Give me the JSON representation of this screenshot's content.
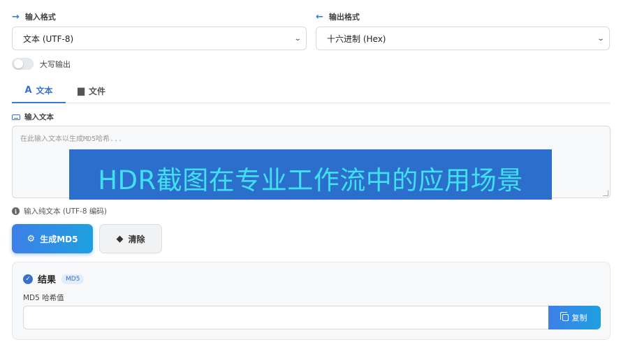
{
  "input_format": {
    "label": "输入格式",
    "selected": "文本 (UTF-8)",
    "arrow_icon": "arrow-right-icon"
  },
  "output_format": {
    "label": "输出格式",
    "selected": "十六进制 (Hex)",
    "arrow_icon": "arrow-left-icon"
  },
  "uppercase_toggle": {
    "label": "大写输出",
    "on": false
  },
  "tabs": [
    {
      "label": "文本",
      "icon": "font-icon",
      "active": true
    },
    {
      "label": "文件",
      "icon": "file-icon",
      "active": false
    }
  ],
  "text_input": {
    "label": "输入文本",
    "placeholder": "在此输入文本以生成MD5哈希..."
  },
  "overlay_banner": "HDR截图在专业工作流中的应用场景",
  "hint": "输入纯文本 (UTF-8 编码)",
  "buttons": {
    "generate": "生成MD5",
    "clear": "清除"
  },
  "result": {
    "title": "结果",
    "badge": "MD5",
    "hash_label": "MD5 哈希值",
    "hash_value": "",
    "copy": "复制"
  },
  "colors": {
    "accent": "#3a7bd5",
    "banner_bg": "#2b6ecb",
    "banner_text": "#40e0f0"
  }
}
